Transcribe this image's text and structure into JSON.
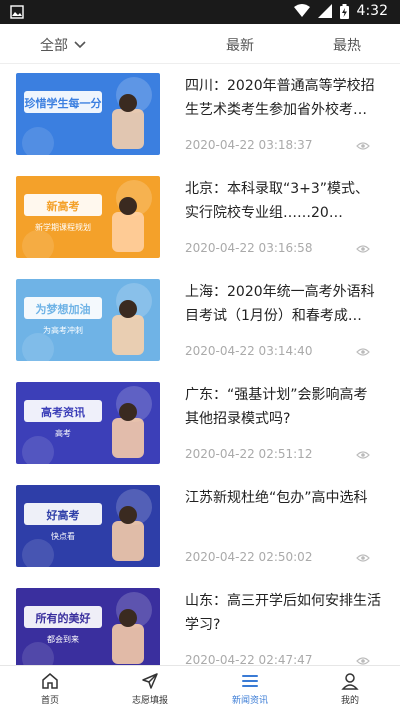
{
  "status": {
    "time": "4:32"
  },
  "tabs": {
    "all": "全部",
    "latest": "最新",
    "hot": "最热"
  },
  "news": [
    {
      "title": "四川：2020年普通高等学校招生艺术类考生参加省外校考…",
      "date": "2020-04-22 03:18:37",
      "thumb_text": "珍惜学生每一分",
      "thumb_sub": "",
      "thumb_color": "#3b7fe0"
    },
    {
      "title": "北京：本科录取“3+3”模式、实行院校专业组……20…",
      "date": "2020-04-22 03:16:58",
      "thumb_text": "新高考",
      "thumb_sub": "新学期课程规划",
      "thumb_color": "#f4a12a"
    },
    {
      "title": "上海：2020年统一高考外语科目考试（1月份）和春考成…",
      "date": "2020-04-22 03:14:40",
      "thumb_text": "为梦想加油",
      "thumb_sub": "为高考冲刺",
      "thumb_color": "#6fb3e6"
    },
    {
      "title": "广东：“强基计划”会影响高考其他招录模式吗?",
      "date": "2020-04-22 02:51:12",
      "thumb_text": "高考资讯",
      "thumb_sub": "高考",
      "thumb_color": "#3c3fb8"
    },
    {
      "title": "江苏新规杜绝“包办”高中选科",
      "date": "2020-04-22 02:50:02",
      "thumb_text": "好高考",
      "thumb_sub": "快点看",
      "thumb_color": "#2e3ea8"
    },
    {
      "title": "山东：高三开学后如何安排生活学习?",
      "date": "2020-04-22 02:47:47",
      "thumb_text": "所有的美好",
      "thumb_sub": "都会到来",
      "thumb_color": "#3a2f9e"
    }
  ],
  "nav": {
    "home": "首页",
    "apply": "志愿填报",
    "news": "新闻资讯",
    "mine": "我的"
  },
  "colors": {
    "accent": "#3a7bd5"
  }
}
